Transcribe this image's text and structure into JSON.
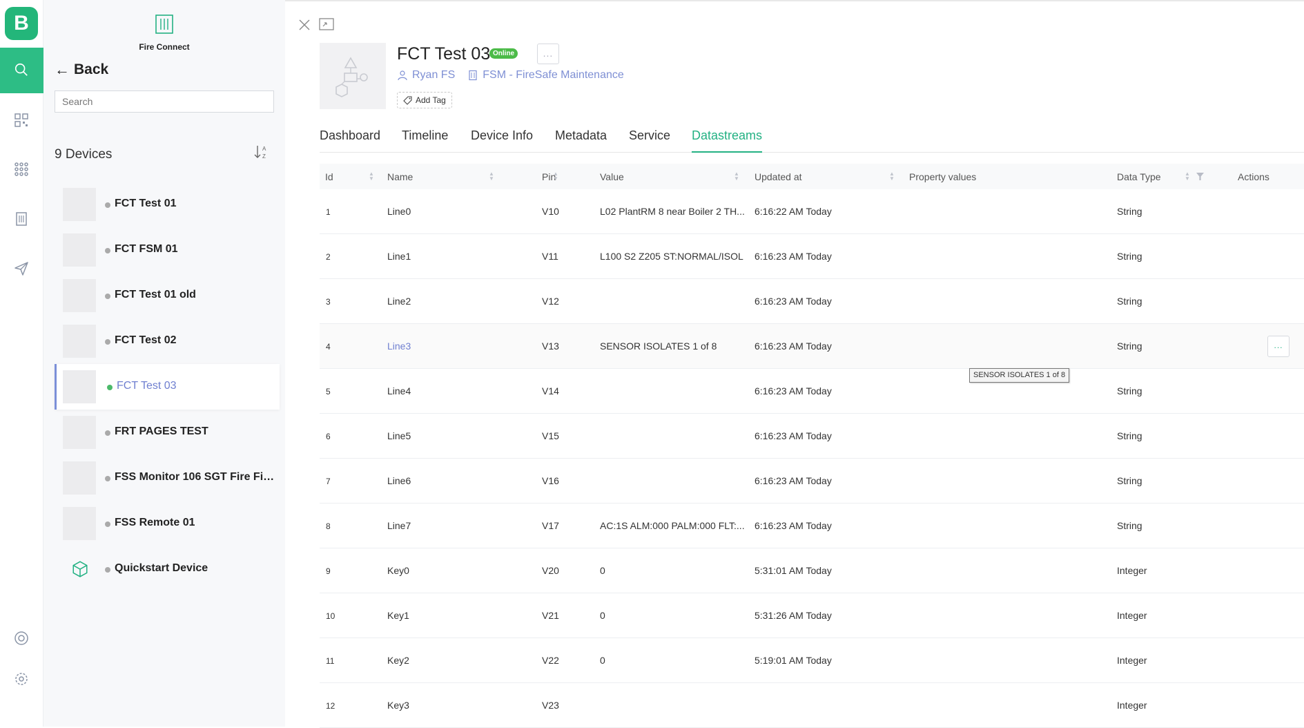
{
  "rail": {
    "logo_letter": "B",
    "icons": [
      "search-icon",
      "qr-code-icon",
      "apps-grid-icon",
      "building-icon",
      "send-icon",
      "support-icon",
      "settings-icon"
    ]
  },
  "brand": {
    "name": "Fire Connect"
  },
  "devices_panel": {
    "back_label": "Back",
    "search_placeholder": "Search",
    "count_label": "9 Devices",
    "devices": [
      {
        "name": "FCT Test 01",
        "status": "offline"
      },
      {
        "name": "FCT FSM 01",
        "status": "offline"
      },
      {
        "name": "FCT Test 01 old",
        "status": "offline"
      },
      {
        "name": "FCT Test 02",
        "status": "offline"
      },
      {
        "name": "FCT Test 03",
        "status": "online",
        "selected": true
      },
      {
        "name": "FRT PAGES TEST",
        "status": "offline"
      },
      {
        "name": "FSS Monitor 106 SGT Fire Find...",
        "status": "offline"
      },
      {
        "name": "FSS Remote 01",
        "status": "offline"
      },
      {
        "name": "Quickstart Device",
        "status": "offline"
      }
    ]
  },
  "device": {
    "title": "FCT Test 03",
    "status_badge": "Online",
    "more_label": "...",
    "owner": "Ryan FS",
    "organization": "FSM - FireSafe Maintenance",
    "add_tag_label": "Add Tag"
  },
  "tabs": [
    "Dashboard",
    "Timeline",
    "Device Info",
    "Metadata",
    "Service",
    "Datastreams"
  ],
  "active_tab": "Datastreams",
  "table": {
    "columns": [
      "Id",
      "Name",
      "Pin",
      "Value",
      "Updated at",
      "Property values",
      "Data Type",
      "Actions"
    ],
    "rows": [
      {
        "id": "1",
        "name": "Line0",
        "pin": "V10",
        "value": "L02 PlantRM 8 near Boiler 2 TH...",
        "updated": "6:16:22 AM Today",
        "property": "",
        "type": "String"
      },
      {
        "id": "2",
        "name": "Line1",
        "pin": "V11",
        "value": "L100 S2 Z205 ST:NORMAL/ISOL",
        "updated": "6:16:23 AM Today",
        "property": "",
        "type": "String"
      },
      {
        "id": "3",
        "name": "Line2",
        "pin": "V12",
        "value": "",
        "updated": "6:16:23 AM Today",
        "property": "",
        "type": "String"
      },
      {
        "id": "4",
        "name": "Line3",
        "pin": "V13",
        "value": "SENSOR ISOLATES 1 of 8",
        "updated": "6:16:23 AM Today",
        "property": "",
        "type": "String"
      },
      {
        "id": "5",
        "name": "Line4",
        "pin": "V14",
        "value": "",
        "updated": "6:16:23 AM Today",
        "property": "",
        "type": "String"
      },
      {
        "id": "6",
        "name": "Line5",
        "pin": "V15",
        "value": "",
        "updated": "6:16:23 AM Today",
        "property": "",
        "type": "String"
      },
      {
        "id": "7",
        "name": "Line6",
        "pin": "V16",
        "value": "",
        "updated": "6:16:23 AM Today",
        "property": "",
        "type": "String"
      },
      {
        "id": "8",
        "name": "Line7",
        "pin": "V17",
        "value": "AC:1S ALM:000 PALM:000 FLT:...",
        "updated": "6:16:23 AM Today",
        "property": "",
        "type": "String"
      },
      {
        "id": "9",
        "name": "Key0",
        "pin": "V20",
        "value": "0",
        "updated": "5:31:01 AM Today",
        "property": "",
        "type": "Integer"
      },
      {
        "id": "10",
        "name": "Key1",
        "pin": "V21",
        "value": "0",
        "updated": "5:31:26 AM Today",
        "property": "",
        "type": "Integer"
      },
      {
        "id": "11",
        "name": "Key2",
        "pin": "V22",
        "value": "0",
        "updated": "5:19:01 AM Today",
        "property": "",
        "type": "Integer"
      },
      {
        "id": "12",
        "name": "Key3",
        "pin": "V23",
        "value": "",
        "updated": "",
        "property": "",
        "type": "Integer"
      }
    ],
    "hover_row_actions": "...",
    "tooltip": "SENSOR ISOLATES 1 of 8"
  },
  "colors": {
    "accent": "#23b183",
    "link": "#6f7fd0",
    "online": "#4cbb48",
    "logo_bg": "#23b67a"
  }
}
